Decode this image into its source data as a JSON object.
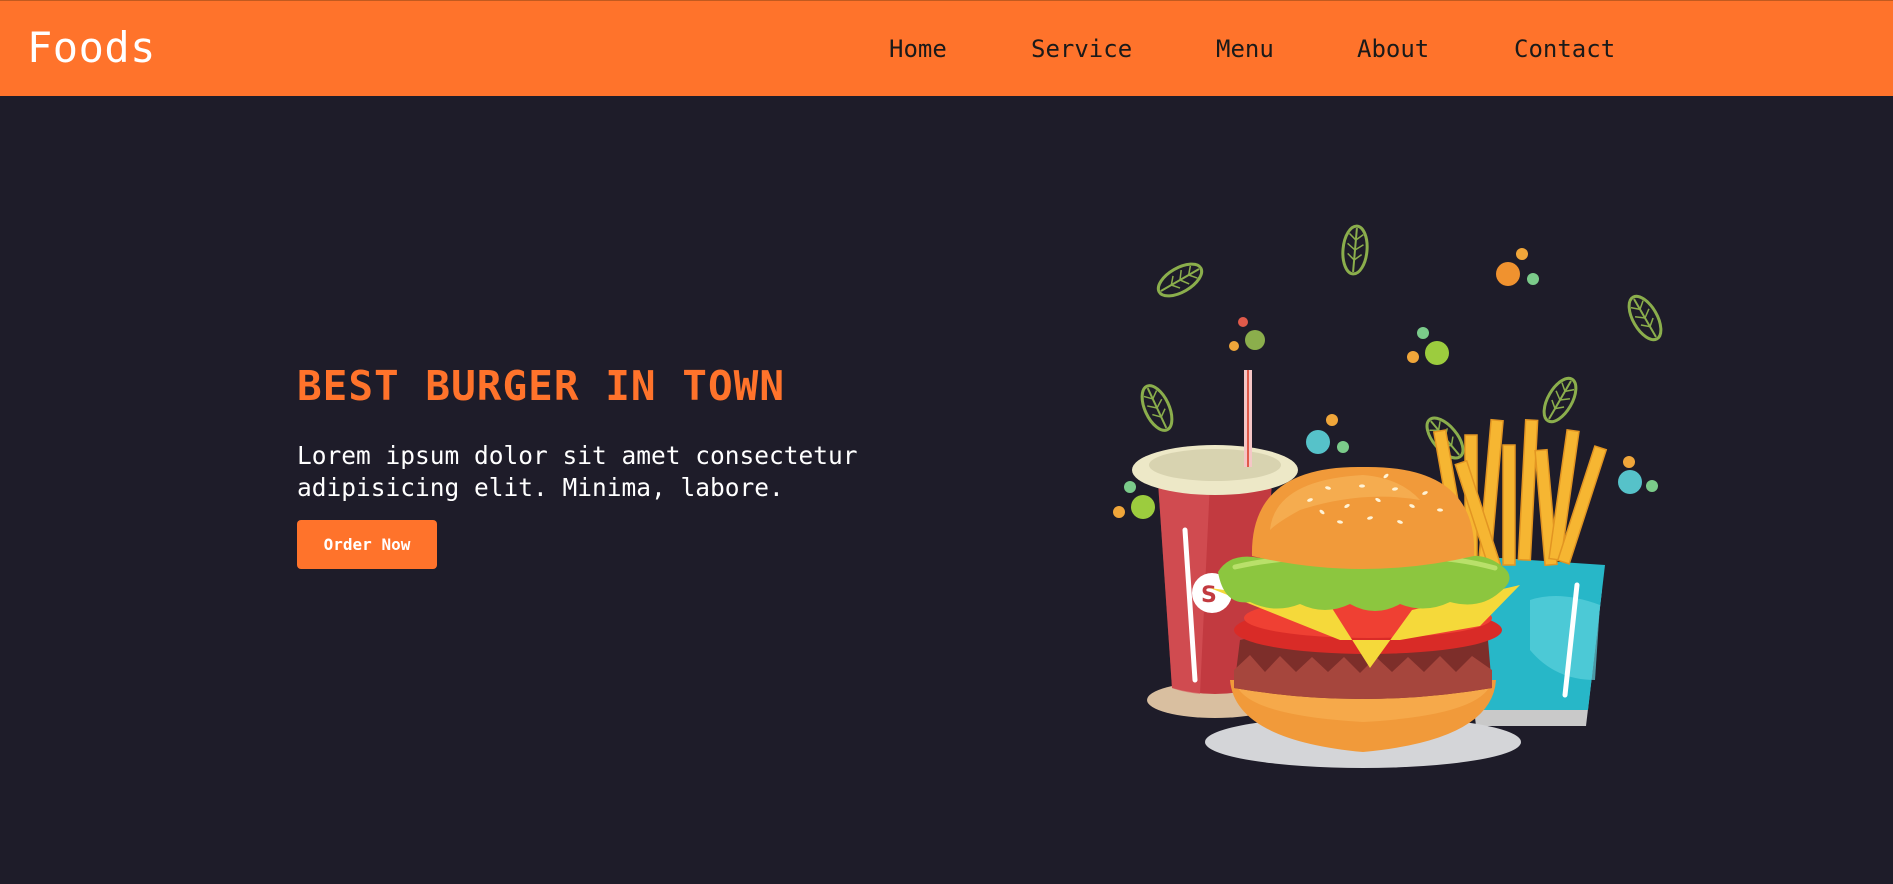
{
  "header": {
    "logo": "Foods",
    "nav": [
      "Home",
      "Service",
      "Menu",
      "About",
      "Contact"
    ]
  },
  "hero": {
    "title": "BEST BURGER IN TOWN",
    "text": "Lorem ipsum dolor sit amet consectetur adipisicing elit. Minima, labore.",
    "button_label": "Order Now"
  },
  "illustration": {
    "subject": "burger-drink-fries-illustration"
  },
  "colors": {
    "accent": "#ff732b",
    "background": "#1e1c29",
    "text": "#ffffff",
    "nav_text": "#1a1a1a"
  }
}
